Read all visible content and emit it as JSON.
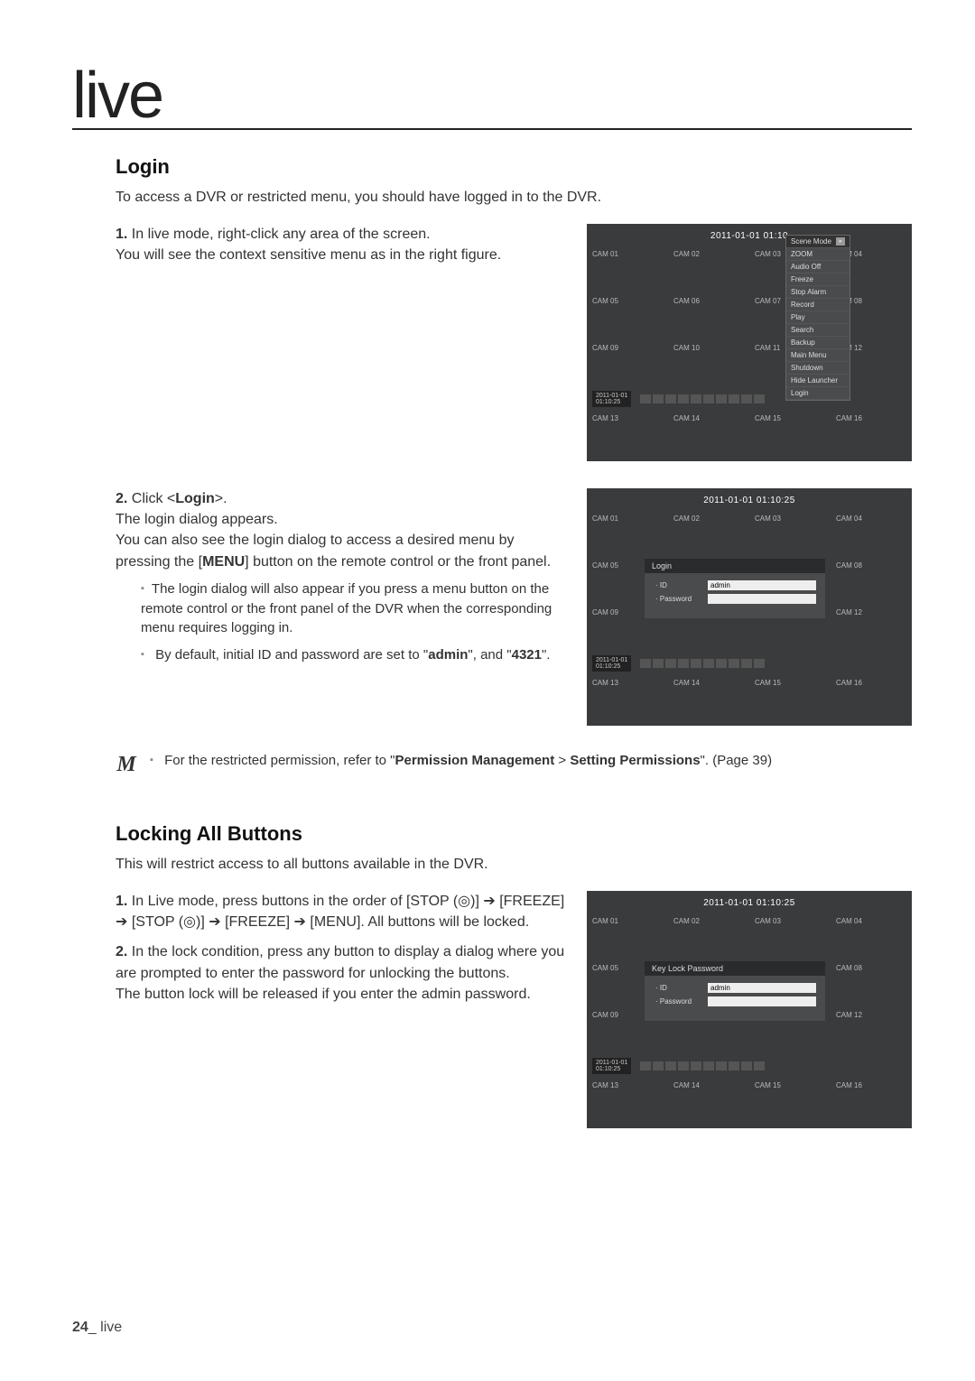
{
  "page": {
    "title": "live",
    "footer_page": "24",
    "footer_section": "_ live"
  },
  "login": {
    "heading": "Login",
    "intro": "To access a DVR or restricted menu, you should have logged in to the DVR.",
    "step1_num": "1.",
    "step1_a": "In live mode, right-click any area of the screen.",
    "step1_b": "You will see the context sensitive menu as in the right figure.",
    "step2_num": "2.",
    "step2_a": "Click <",
    "step2_login": "Login",
    "step2_b": ">.",
    "step2_c": "The login dialog appears.",
    "step2_d": "You can also see the login dialog to access a desired menu by pressing the [",
    "step2_menu": "MENU",
    "step2_e": "] button on the remote control or the front panel.",
    "sub1": "The login dialog will also appear if you press a menu button on the remote control or the front panel of the DVR when the corresponding menu requires logging in.",
    "sub2_a": "By default, initial ID and password are set to \"",
    "sub2_admin": "admin",
    "sub2_b": "\", and \"",
    "sub2_pw": "4321",
    "sub2_c": "\".",
    "note_a": "For the restricted permission, refer to \"",
    "note_b": "Permission Management",
    "note_c": " > ",
    "note_d": "Setting Permissions",
    "note_e": "\". (Page 39)"
  },
  "lock": {
    "heading": "Locking All Buttons",
    "intro": "This will restrict access to all buttons available in the DVR.",
    "step1_num": "1.",
    "step1": "In Live mode, press buttons in the order of [STOP (◎)] ➔ [FREEZE] ➔ [STOP (◎)] ➔ [FREEZE] ➔ [MENU]. All buttons will be locked.",
    "step2_num": "2.",
    "step2_a": "In the lock condition, press any button to display a dialog where you are prompted to enter the password for unlocking the buttons.",
    "step2_b": "The button lock will be released if you enter the admin password."
  },
  "dvr": {
    "clock1": "2011-01-01 01:10",
    "clock2": "2011-01-01 01:10:25",
    "launcher_date": "2011-01-01",
    "launcher_time": "01:10:25",
    "cams": [
      "CAM 01",
      "CAM 02",
      "CAM 03",
      "CAM 04",
      "CAM 05",
      "CAM 06",
      "CAM 07",
      "CAM 08",
      "CAM 09",
      "CAM 10",
      "CAM 11",
      "CAM 12",
      "CAM 13",
      "CAM 14",
      "CAM 15",
      "CAM 16"
    ],
    "ctx": {
      "header": "Scene Mode",
      "hdr_right": "▸",
      "items": [
        "ZOOM",
        "Audio Off",
        "Freeze",
        "Stop Alarm",
        "Record",
        "Play",
        "Search",
        "Backup",
        "Main Menu",
        "Shutdown",
        "Hide Launcher",
        "Login"
      ]
    },
    "dialog_login": {
      "title": "Login",
      "id_label": "· ID",
      "id_value": "admin",
      "pw_label": "· Password"
    },
    "dialog_keylock": {
      "title": "Key Lock Password",
      "id_label": "· ID",
      "id_value": "admin",
      "pw_label": "· Password"
    }
  }
}
